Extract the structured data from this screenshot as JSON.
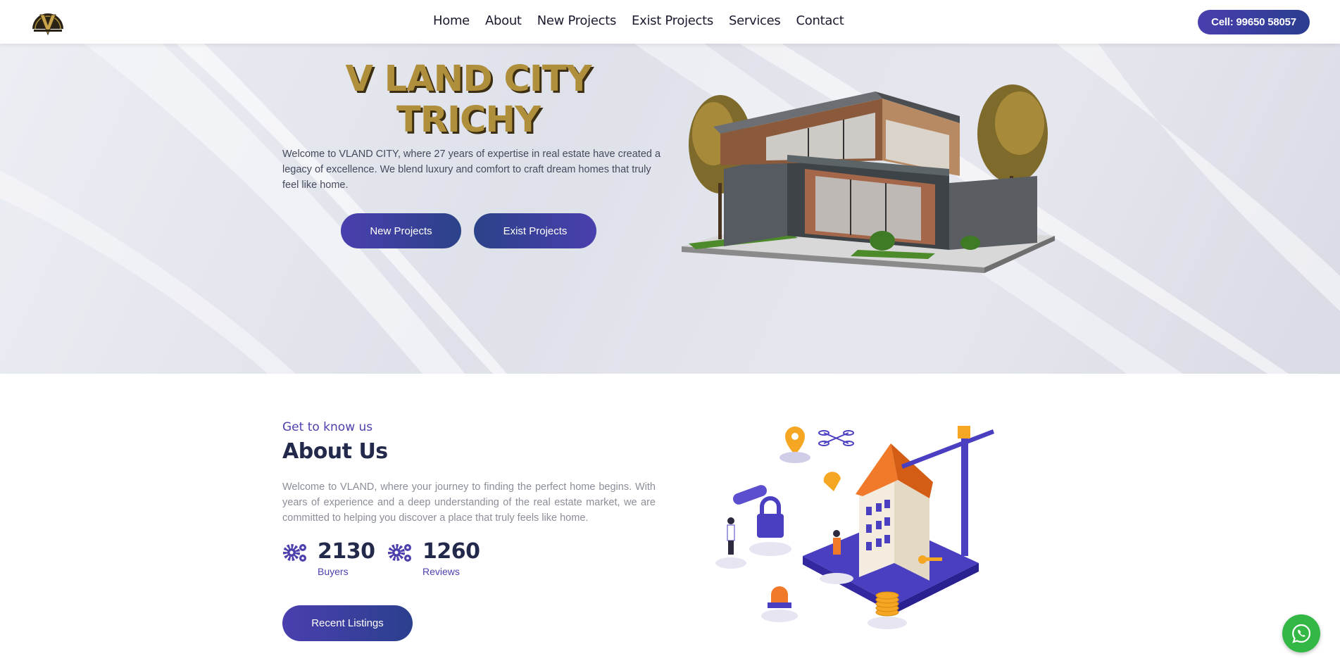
{
  "nav": {
    "items": [
      {
        "label": "Home"
      },
      {
        "label": "About"
      },
      {
        "label": "New Projects"
      },
      {
        "label": "Exist Projects"
      },
      {
        "label": "Services"
      },
      {
        "label": "Contact"
      }
    ],
    "cell_label": "Cell: 99650 58057"
  },
  "hero": {
    "title_line1": "V LAND CITY",
    "title_line2": "TRICHY",
    "text": "Welcome to VLAND CITY, where 27 years of expertise in real estate have created a legacy of excellence. We blend luxury and comfort to craft dream homes that truly feel like home.",
    "btn_new": "New Projects",
    "btn_exist": "Exist Projects"
  },
  "about": {
    "subtitle": "Get to know us",
    "title": "About Us",
    "text": "Welcome to VLAND, where your journey to finding the perfect home begins. With years of experience and a deep understanding of the real estate market, we are committed to helping you discover a place that truly feels like home.",
    "stats": [
      {
        "value": "2130",
        "label": "Buyers"
      },
      {
        "value": "1260",
        "label": "Reviews"
      }
    ],
    "btn_recent": "Recent Listings"
  },
  "colors": {
    "accent": "#4a3fae",
    "title_gold": "#b08f3c",
    "whatsapp": "#33b845"
  }
}
